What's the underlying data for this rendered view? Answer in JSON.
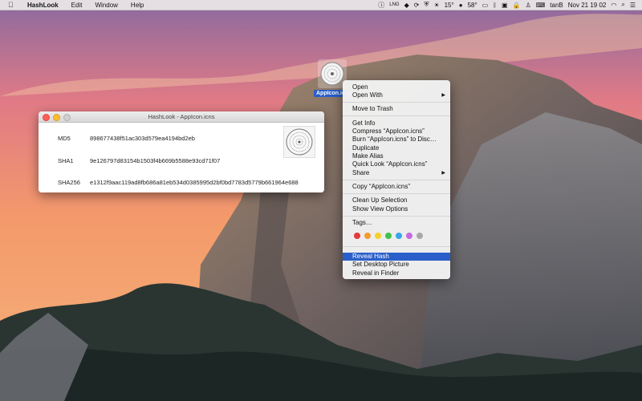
{
  "menubar": {
    "app_name": "HashLook",
    "menus": [
      "Edit",
      "Window",
      "Help"
    ],
    "status": {
      "lang": "LNG",
      "temp": "15°",
      "temp2": "58°",
      "datetime": "Nov 21  19 02",
      "user": "tanB"
    }
  },
  "desktop_file": {
    "name": "AppIcon.icns"
  },
  "window": {
    "title": "HashLook - AppIcon.icns",
    "hashes": [
      {
        "label": "MD5",
        "value": "898677438f51ac303d579ea4194bd2eb"
      },
      {
        "label": "SHA1",
        "value": "9e126797d83154b1503f4b669b5588e93cd71f07"
      },
      {
        "label": "SHA256",
        "value": "e1312f9aac119ad8fb686a81eb534d0385995d2bf0bd7783d5779b661964e688"
      }
    ]
  },
  "context_menu": {
    "items": {
      "open": "Open",
      "open_with": "Open With",
      "move_to_trash": "Move to Trash",
      "get_info": "Get Info",
      "compress": "Compress “AppIcon.icns”",
      "burn": "Burn “AppIcon.icns” to Disc…",
      "duplicate": "Duplicate",
      "make_alias": "Make Alias",
      "quick_look": "Quick Look “AppIcon.icns”",
      "share": "Share",
      "copy": "Copy “AppIcon.icns”",
      "clean_up": "Clean Up Selection",
      "show_view_options": "Show View Options",
      "tags": "Tags…",
      "reveal_hash": "Reveal Hash",
      "set_desktop_picture": "Set Desktop Picture",
      "reveal_in_finder": "Reveal in Finder"
    },
    "tag_colors": [
      "#e23b3b",
      "#f39b2b",
      "#f3d12b",
      "#3fc24a",
      "#38a6e8",
      "#c46be0",
      "#a8a8a8"
    ],
    "selection_color": "#2a5fc9"
  }
}
